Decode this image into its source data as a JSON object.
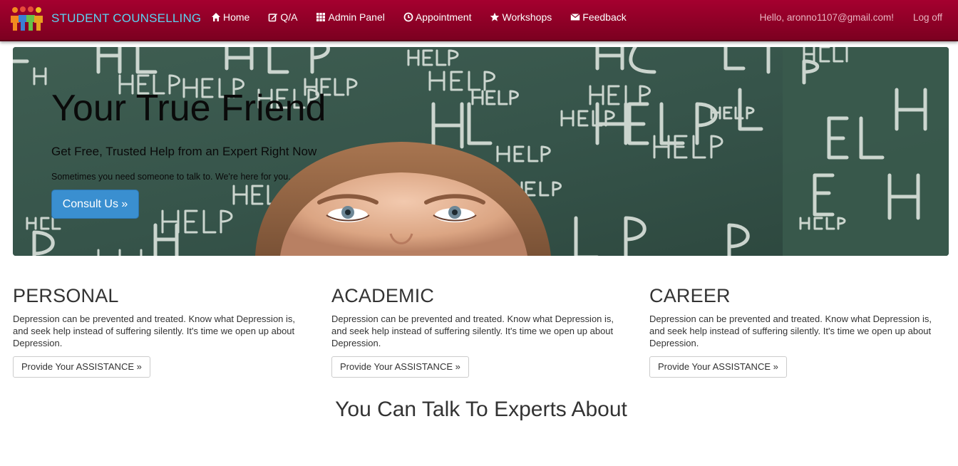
{
  "navbar": {
    "brand": "STUDENT COUNSELLING",
    "items": [
      {
        "label": "Home",
        "icon": "home-icon"
      },
      {
        "label": "Q/A",
        "icon": "edit-icon"
      },
      {
        "label": "Admin Panel",
        "icon": "grid-icon"
      },
      {
        "label": "Appointment",
        "icon": "clock-icon"
      },
      {
        "label": "Workshops",
        "icon": "star-icon"
      },
      {
        "label": "Feedback",
        "icon": "envelope-icon"
      }
    ],
    "greeting": "Hello, aronno1107@gmail.com!",
    "logoff": "Log off"
  },
  "hero": {
    "title": "Your True Friend",
    "subtitle": "Get Free, Trusted Help from an Expert Right Now",
    "small": "Sometimes you need someone to talk to. We're here for you.",
    "button": "Consult Us »"
  },
  "columns": [
    {
      "heading": "PERSONAL",
      "text": "Depression can be prevented and treated. Know what Depression is, and seek help instead of suffering silently. It's time we open up about Depression.",
      "button": "Provide Your ASSISTANCE »"
    },
    {
      "heading": "ACADEMIC",
      "text": "Depression can be prevented and treated. Know what Depression is, and seek help instead of suffering silently. It's time we open up about Depression.",
      "button": "Provide Your ASSISTANCE »"
    },
    {
      "heading": "CAREER",
      "text": "Depression can be prevented and treated. Know what Depression is, and seek help instead of suffering silently. It's time we open up about Depression.",
      "button": "Provide Your ASSISTANCE »"
    }
  ],
  "talk_heading": "You Can Talk To Experts About",
  "colors": {
    "navbar": "#8e0027",
    "brand": "#5bd3f2",
    "primary_button": "#3a8fd0"
  }
}
